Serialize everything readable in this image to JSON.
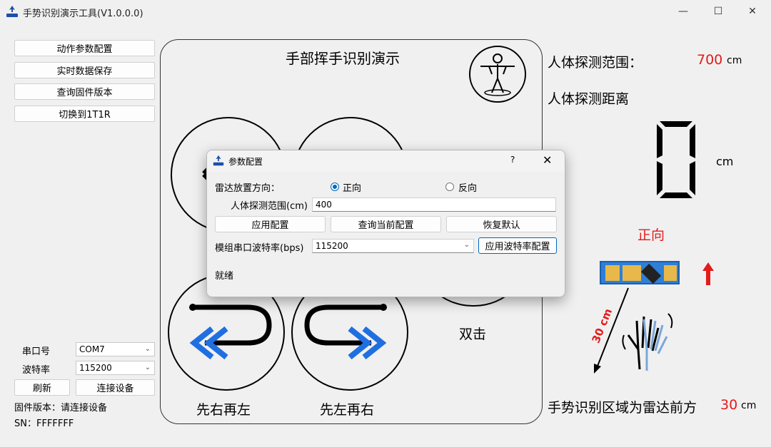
{
  "window": {
    "title": "手势识别演示工具(V1.0.0.0)",
    "controls": [
      "—",
      "☐",
      "✕"
    ]
  },
  "sidebar": {
    "buttons": [
      "动作参数配置",
      "实时数据保存",
      "查询固件版本",
      "切换到1T1R"
    ],
    "port_label": "串口号",
    "port_value": "COM7",
    "baud_label": "波特率",
    "baud_value": "115200",
    "refresh_label": "刷新",
    "connect_label": "连接设备",
    "firmware_text": "固件版本：请连接设备",
    "sn_text": "SN：FFFFFFF"
  },
  "demo": {
    "title": "手部挥手识别演示",
    "gestures": [
      "先右再左",
      "先左再右",
      "双击"
    ]
  },
  "right": {
    "range_label": "人体探测范围：",
    "range_value": "700",
    "range_unit": "cm",
    "distance_label": "人体探测距离",
    "distance_digit": "0",
    "distance_unit": "cm",
    "direction_text": "正向",
    "distance_annotation": "30 cm",
    "region_label": "手势识别区域为雷达前方",
    "region_value": "30",
    "region_unit": "cm"
  },
  "dialog": {
    "title": "参数配置",
    "help": "?",
    "close": "✕",
    "orientation_label": "雷达放置方向：",
    "option_forward": "正向",
    "option_reverse": "反向",
    "selected_option": "正向",
    "range_label": "人体探测范围(cm)",
    "range_value": "400",
    "apply_label": "应用配置",
    "query_label": "查询当前配置",
    "restore_label": "恢复默认",
    "baud_label": "模组串口波特率(bps)",
    "baud_value": "115200",
    "apply_baud_label": "应用波特率配置",
    "status": "就绪"
  },
  "colors": {
    "accent": "#0067c0",
    "red": "#e31b1b",
    "arrow_blue": "#1f6fe0"
  }
}
